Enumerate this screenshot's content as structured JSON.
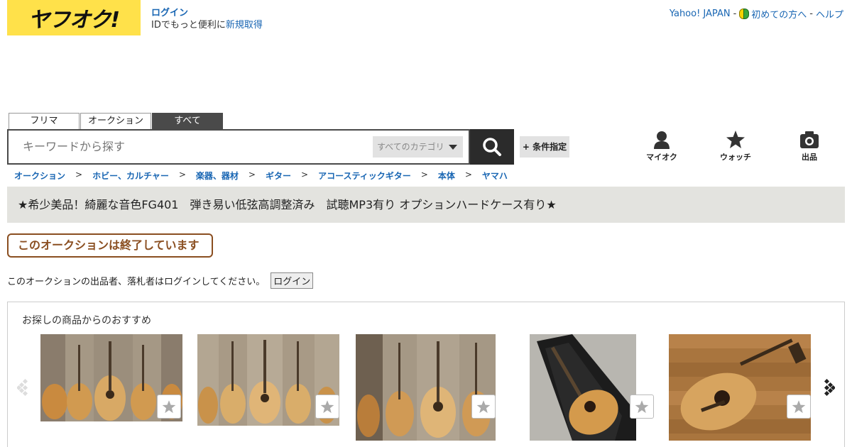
{
  "header": {
    "logo_text": "ヤフオク!",
    "login_label": "ログイン",
    "login_sub_text": "IDでもっと便利に",
    "signup_label": "新規取得",
    "links": [
      {
        "label": "Yahoo! JAPAN",
        "sep": "-"
      },
      {
        "label": "初めての方へ",
        "sep": "-"
      },
      {
        "label": "ヘルプ",
        "sep": ""
      }
    ]
  },
  "search": {
    "tabs": [
      "フリマ",
      "オークション",
      "すべて"
    ],
    "active_tab": "すべて",
    "placeholder": "キーワードから探す",
    "category_label": "すべてのカテゴリ",
    "condition_label": "+ 条件指定",
    "search_icon": "search-icon"
  },
  "side_icons": [
    {
      "label": "マイオク",
      "icon": "person-icon"
    },
    {
      "label": "ウォッチ",
      "icon": "star-icon"
    },
    {
      "label": "出品",
      "icon": "camera-icon"
    }
  ],
  "breadcrumb": [
    "オークション",
    "ホビー、カルチャー",
    "楽器、器材",
    "ギター",
    "アコースティックギター",
    "本体",
    "ヤマハ"
  ],
  "item": {
    "title": "★希少美品！綺麗な音色FG401　弾き易い低弦高調整済み　試聴MP3有り オプションハードケース有り★",
    "ended_label": "このオークションは終了しています",
    "login_notice": "このオークションの出品者、落札者はログインしてください。",
    "login_button": "ログイン"
  },
  "recommendations": {
    "title": "お探しの商品からのおすすめ",
    "items": [
      {
        "image": "guitar-lineup-photo"
      },
      {
        "image": "guitar-lineup-photo"
      },
      {
        "image": "guitar-lineup-photo"
      },
      {
        "image": "guitar-in-case-photo"
      },
      {
        "image": "guitar-on-floor-photo"
      }
    ]
  },
  "colors": {
    "brand_yellow": "#ffe14a",
    "link_blue": "#1966b3",
    "ended_brown": "#8a4e20",
    "title_bg": "#e3e3df"
  }
}
